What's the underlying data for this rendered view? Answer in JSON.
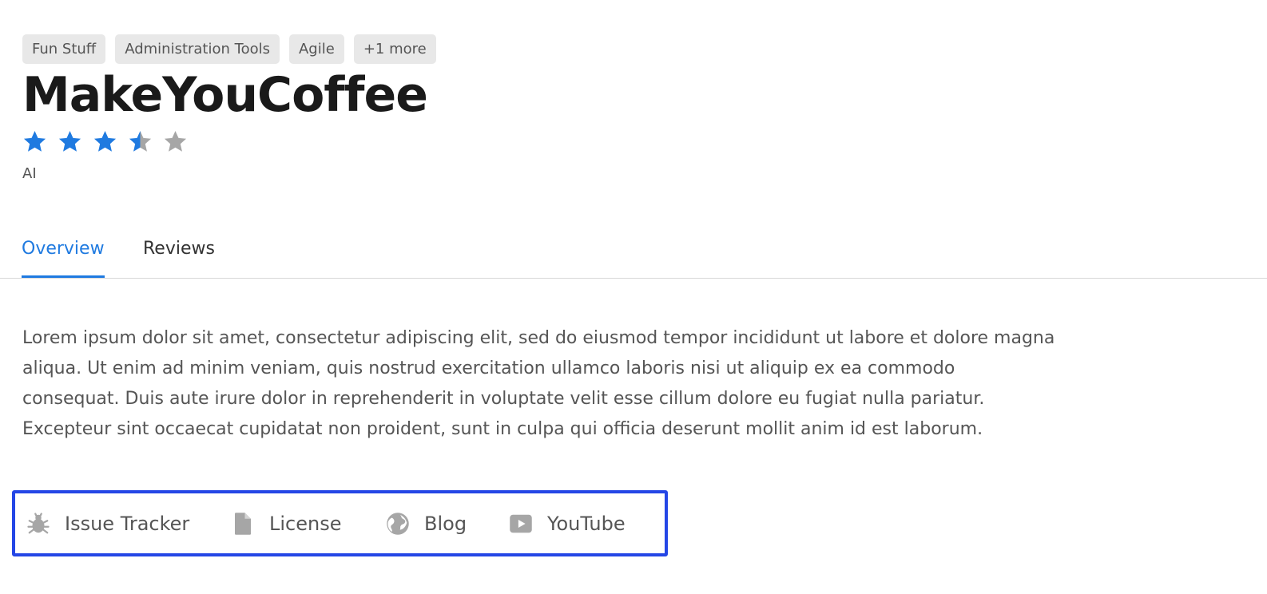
{
  "tags": [
    "Fun Stuff",
    "Administration Tools",
    "Agile",
    "+1 more"
  ],
  "app": {
    "title": "MakeYouCoffee",
    "rating": 3.5,
    "rating_max": 5,
    "author": "AI"
  },
  "tabs": [
    "Overview",
    "Reviews"
  ],
  "active_tab": "Overview",
  "description": "Lorem ipsum dolor sit amet, consectetur adipiscing elit, sed do eiusmod tempor incididunt ut labore et dolore magna aliqua. Ut enim ad minim veniam, quis nostrud exercitation ullamco laboris nisi ut aliquip ex ea commodo consequat. Duis aute irure dolor in reprehenderit in voluptate velit esse cillum dolore eu fugiat nulla pariatur. Excepteur sint occaecat cupidatat non proident, sunt in culpa qui officia deserunt mollit anim id est laborum.",
  "links": [
    {
      "label": "Issue Tracker",
      "icon": "bug-icon"
    },
    {
      "label": "License",
      "icon": "document-icon"
    },
    {
      "label": "Blog",
      "icon": "globe-icon"
    },
    {
      "label": "YouTube",
      "icon": "youtube-icon"
    }
  ],
  "colors": {
    "accent": "#1f7ae0",
    "star_empty": "#a6a6a6",
    "highlight_border": "#2446e6"
  }
}
